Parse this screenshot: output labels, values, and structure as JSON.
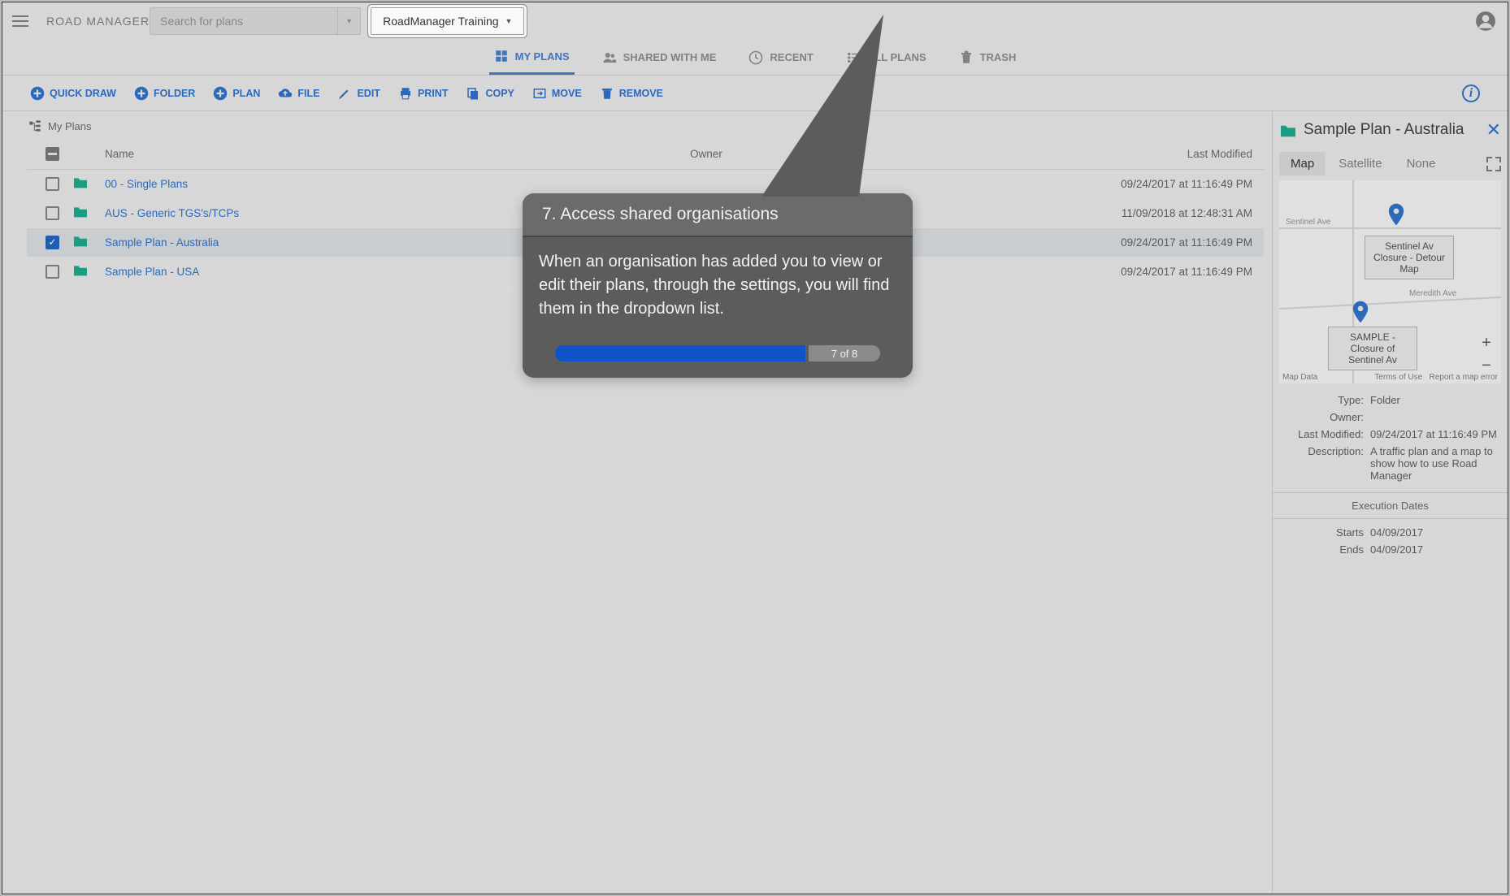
{
  "header": {
    "brand": "ROAD MANAGER",
    "search_placeholder": "Search for plans",
    "organisation": "RoadManager Training"
  },
  "navtabs": {
    "my_plans": "MY PLANS",
    "shared": "SHARED WITH ME",
    "recent": "RECENT",
    "all": "ALL PLANS",
    "trash": "TRASH"
  },
  "toolbar": {
    "quick_draw": "QUICK DRAW",
    "folder": "FOLDER",
    "plan": "PLAN",
    "file": "FILE",
    "edit": "EDIT",
    "print": "PRINT",
    "copy": "COPY",
    "move": "MOVE",
    "remove": "REMOVE"
  },
  "breadcrumb": "My Plans",
  "columns": {
    "name": "Name",
    "owner": "Owner",
    "last_modified": "Last Modified"
  },
  "rows": [
    {
      "name": "00 - Single Plans",
      "owner": "",
      "modified": "09/24/2017 at 11:16:49 PM",
      "selected": false
    },
    {
      "name": "AUS - Generic TGS's/TCPs",
      "owner": "",
      "modified": "11/09/2018 at 12:48:31 AM",
      "selected": false
    },
    {
      "name": "Sample Plan - Australia",
      "owner": "",
      "modified": "09/24/2017 at 11:16:49 PM",
      "selected": true
    },
    {
      "name": "Sample Plan - USA",
      "owner": "",
      "modified": "09/24/2017 at 11:16:49 PM",
      "selected": false
    }
  ],
  "sidepanel": {
    "title": "Sample Plan - Australia",
    "maptabs": {
      "map": "Map",
      "satellite": "Satellite",
      "none": "None"
    },
    "pins": {
      "label1": "Sentinel Av Closure - Detour Map",
      "label2": "SAMPLE - Closure of Sentinel Av"
    },
    "streets": {
      "a": "Sentinel Ave",
      "b": "Meredith Ave"
    },
    "credits": {
      "left": "Map Data",
      "mid": "Terms of Use",
      "right": "Report a map error"
    },
    "meta": {
      "type_k": "Type:",
      "type_v": "Folder",
      "owner_k": "Owner:",
      "owner_v": "",
      "lm_k": "Last Modified:",
      "lm_v": "09/24/2017 at 11:16:49 PM",
      "desc_k": "Description:",
      "desc_v": "A traffic plan and a map to show how to use Road Manager",
      "exec_hdr": "Execution Dates",
      "starts_k": "Starts",
      "starts_v": "04/09/2017",
      "ends_k": "Ends",
      "ends_v": "04/09/2017"
    }
  },
  "tutorial": {
    "title": "7. Access shared organisations",
    "body": "When an organisation has added you to view or edit their plans, through the settings, you will find them in the dropdown list.",
    "progress_label": "7 of 8",
    "progress_pct": 77
  }
}
